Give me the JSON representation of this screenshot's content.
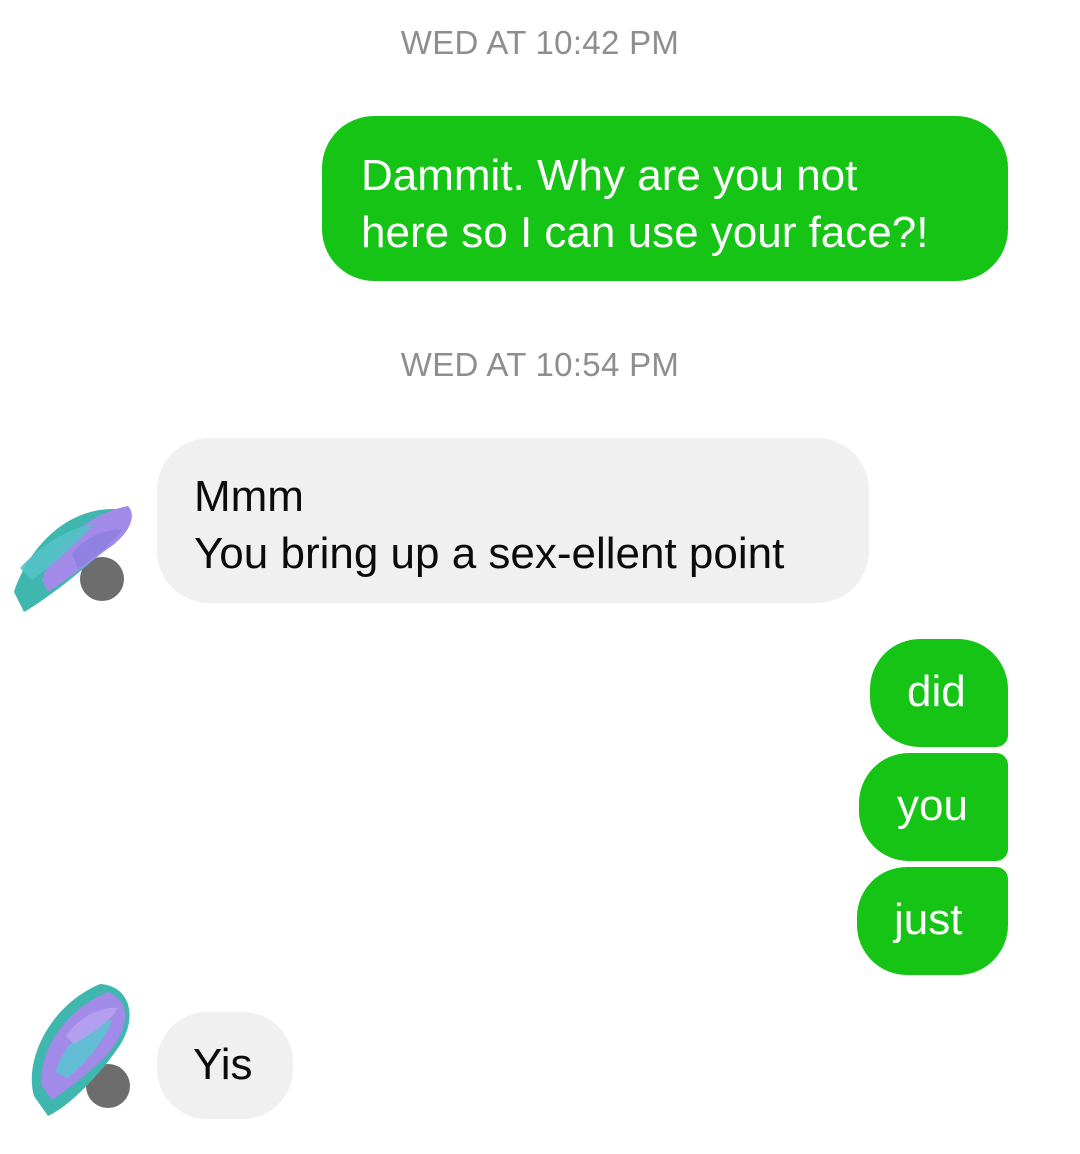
{
  "thread": {
    "timestamps": {
      "first": "WED AT 10:42 PM",
      "second": "WED AT 10:54 PM"
    },
    "messages": {
      "m1": "Dammit. Why are you not\nhere so I can use your face?!",
      "m2": "Mmm\nYou bring up a sex-ellent point",
      "m3": "did",
      "m4": "you",
      "m5": "just",
      "m6": "Yis"
    }
  },
  "colors": {
    "outgoing_bubble": "#16c416",
    "incoming_bubble": "#f1f0f0",
    "timestamp_text": "#8e8e8e",
    "avatar_scribble_purple": "#9b86e6",
    "avatar_scribble_teal": "#2fb8b0"
  },
  "icons": {
    "avatar": "scribbled-out-avatar-icon"
  }
}
